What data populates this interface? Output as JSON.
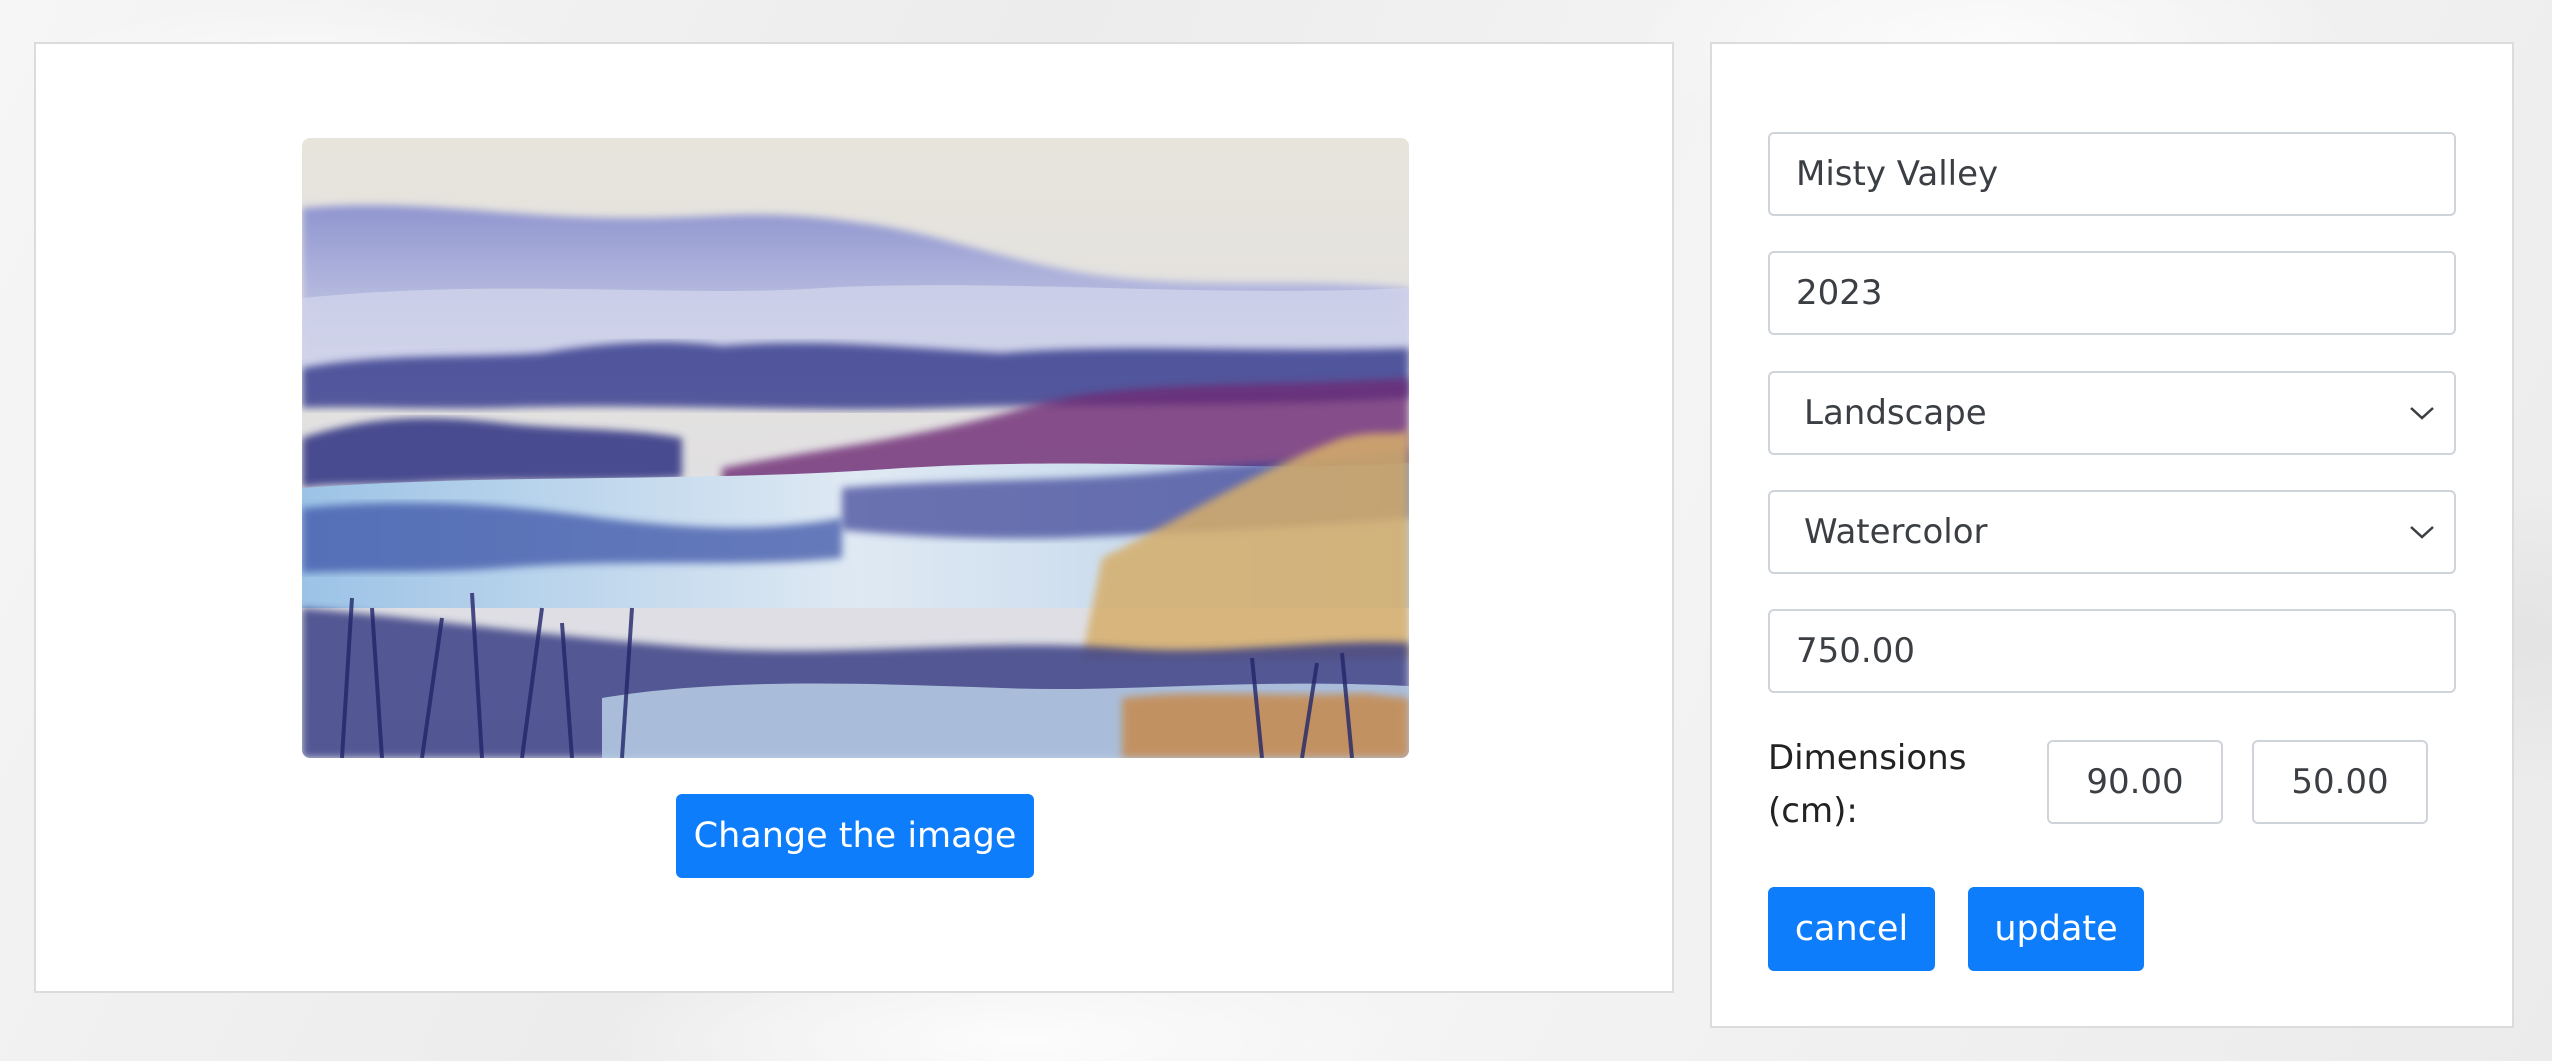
{
  "image_panel": {
    "change_image_label": "Change the image"
  },
  "form": {
    "title_value": "Misty Valley",
    "year_value": "2023",
    "genre_selected": "Landscape",
    "medium_selected": "Watercolor",
    "price_value": "750.00",
    "dimensions_label": "Dimensions (cm):",
    "width_value": "90.00",
    "height_value": "50.00",
    "cancel_label": "cancel",
    "update_label": "update"
  },
  "icons": {
    "select_arrow": "chevron-down-icon"
  },
  "colors": {
    "primary_button": "#0d7dfb",
    "field_border": "#cfd4da"
  }
}
